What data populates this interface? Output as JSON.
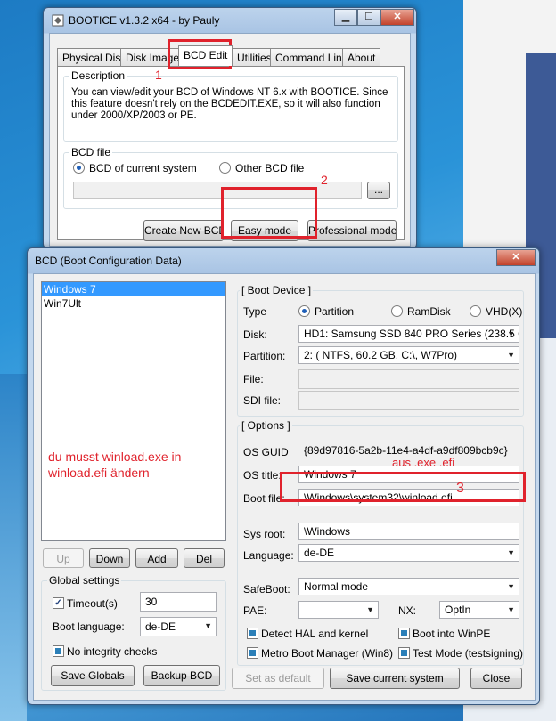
{
  "bootice": {
    "title": "BOOTICE v1.3.2 x64 - by Pauly",
    "tabs": [
      "Physical Disk",
      "Disk Image",
      "BCD Edit",
      "Utilities",
      "Command Line",
      "About"
    ],
    "active_tab": "BCD Edit",
    "description_label": "Description",
    "description_text": "You can view/edit your BCD of Windows NT 6.x with BOOTICE. Since this feature doesn't rely on the BCDEDIT.EXE, so it will also function under 2000/XP/2003 or PE.",
    "bcd_file_label": "BCD file",
    "radio_current": "BCD of current system",
    "radio_other": "Other BCD file",
    "browse_label": "...",
    "btn_create": "Create New BCD",
    "btn_easy": "Easy mode",
    "btn_professional": "Professional mode"
  },
  "annotations": {
    "one": "1",
    "two": "2",
    "three": "3",
    "hint_line1": "du musst winload.exe in",
    "hint_line2": "winload.efi ändern",
    "exe_to_efi": "aus .exe  .efi"
  },
  "bcd": {
    "title": "BCD (Boot Configuration Data)",
    "entries": [
      "Windows 7",
      "Win7Ult"
    ],
    "selected_entry": "Windows 7",
    "btn_up": "Up",
    "btn_down": "Down",
    "btn_add": "Add",
    "btn_del": "Del",
    "global_settings_label": "Global settings",
    "timeout_label": "Timeout(s)",
    "timeout_value": "30",
    "boot_language_label": "Boot language:",
    "boot_language_value": "de-DE",
    "no_integrity_label": "No integrity checks",
    "btn_save_globals": "Save Globals",
    "btn_backup": "Backup BCD",
    "boot_device_label": "[ Boot Device ]",
    "type_label": "Type",
    "type_partition": "Partition",
    "type_ramdisk": "RamDisk",
    "type_vhd": "VHD(X)",
    "disk_label": "Disk:",
    "disk_value": "HD1: Samsung SSD 840 PRO Series (238.5 GB,",
    "partition_label": "Partition:",
    "partition_value": "2: ( NTFS,  60.2 GB, C:\\, W7Pro)",
    "file_label": "File:",
    "file_value": "",
    "sdi_label": "SDI file:",
    "sdi_value": "",
    "options_label": "[ Options ]",
    "os_guid_label": "OS GUID",
    "os_guid_value": "{89d97816-5a2b-11e4-a4df-a9df809bcb9c}",
    "os_title_label": "OS title:",
    "os_title_value": "Windows 7",
    "boot_file_label": "Boot file:",
    "boot_file_value": "\\Windows\\system32\\winload.efi",
    "sys_root_label": "Sys root:",
    "sys_root_value": "\\Windows",
    "language_label": "Language:",
    "language_value": "de-DE",
    "safeboot_label": "SafeBoot:",
    "safeboot_value": "Normal mode",
    "pae_label": "PAE:",
    "pae_value": "",
    "nx_label": "NX:",
    "nx_value": "OptIn",
    "detect_hal_label": "Detect HAL and kernel",
    "boot_winpe_label": "Boot into WinPE",
    "metro_label": "Metro Boot Manager (Win8)",
    "test_mode_label": "Test Mode (testsigning)",
    "btn_set_default": "Set as default",
    "btn_save_current": "Save current system",
    "btn_close": "Close"
  }
}
